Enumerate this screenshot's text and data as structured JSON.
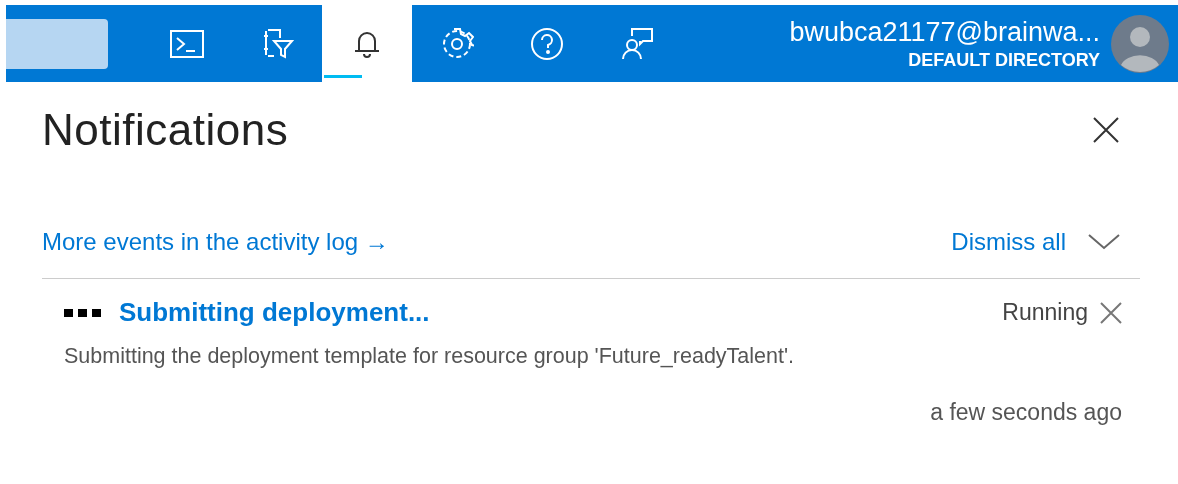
{
  "toolbar": [
    {
      "kind": "terminal",
      "selected": false
    },
    {
      "kind": "filter",
      "selected": false
    },
    {
      "kind": "bell",
      "selected": true
    },
    {
      "kind": "gear",
      "selected": false
    },
    {
      "kind": "help",
      "selected": false
    },
    {
      "kind": "feedback",
      "selected": false
    }
  ],
  "account": {
    "user": "bwubca21177@brainwa...",
    "directory": "DEFAULT DIRECTORY"
  },
  "panel": {
    "title": "Notifications",
    "activity_link": "More events in the activity log →",
    "dismiss": "Dismiss all"
  },
  "notifications": [
    {
      "title": "Submitting deployment...",
      "status": "Running",
      "message": "Submitting the deployment template for resource group 'Future_readyTalent'.",
      "time": "a few seconds ago"
    }
  ]
}
